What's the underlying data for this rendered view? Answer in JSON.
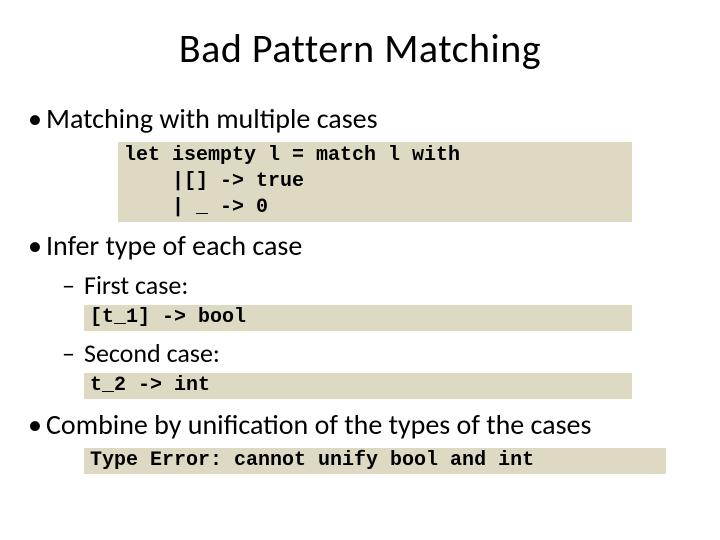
{
  "title": "Bad Pattern Matching",
  "bullets": {
    "b1": "Matching with multiple cases",
    "b2": "Infer type of each case",
    "b2a": "First case:",
    "b2b": "Second case:",
    "b3": "Combine by unification of the types of the cases"
  },
  "code": {
    "main": "let isempty l = match l with\n    |[] -> true\n    | _ -> 0",
    "case1": "[t_1] -> bool",
    "case2": "t_2 -> int",
    "error": "Type Error: cannot unify bool and int"
  }
}
